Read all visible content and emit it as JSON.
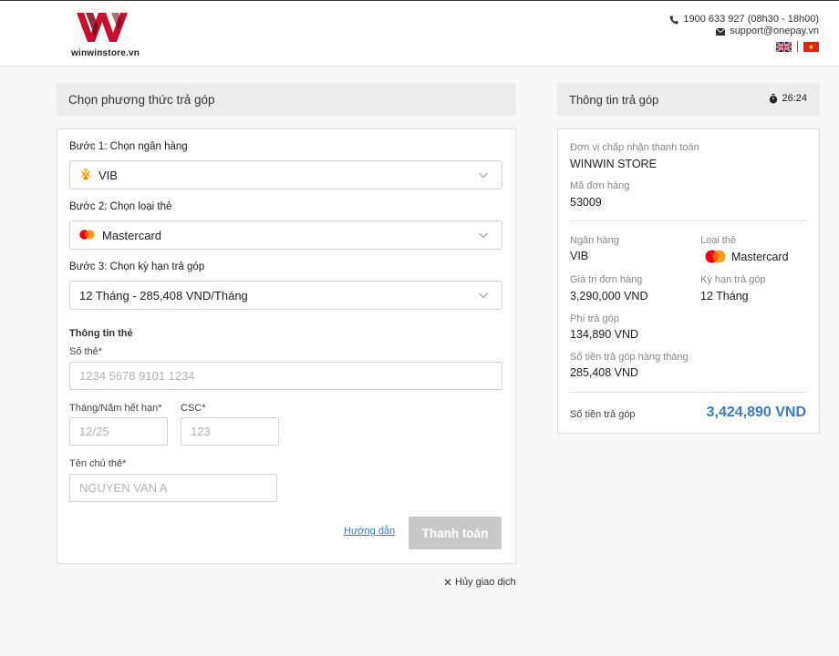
{
  "header": {
    "logo_text": "winwinstore.vn",
    "phone": "1900 633 927 (08h30 - 18h00)",
    "email": "support@onepay.vn"
  },
  "left_panel": {
    "title": "Chọn phương thức trả góp",
    "step1_label": "Bước 1: Chọn ngân hàng",
    "bank_value": "VIB",
    "step2_label": "Bước 2: Chọn loại thẻ",
    "card_type_value": "Mastercard",
    "step3_label": "Bước 3: Chọn kỳ hạn trả góp",
    "term_value": "12 Tháng - 285,408 VND/Tháng",
    "card_info_title": "Thông tin thẻ",
    "card_number_label": "Số thẻ*",
    "card_number_placeholder": "1234 5678 9101 1234",
    "expiry_label": "Tháng/Năm hết hạn*",
    "expiry_placeholder": "12/25",
    "csc_label": "CSC*",
    "csc_placeholder": "123",
    "holder_label": "Tên chủ thẻ*",
    "holder_placeholder": "NGUYEN VAN A",
    "help_link": "Hướng dẫn",
    "pay_button": "Thanh toán"
  },
  "cancel_label": "Hủy giao dịch",
  "right_panel": {
    "title": "Thông tin trả góp",
    "timer": "26:24",
    "merchant_label": "Đơn vị chấp nhận thanh toán",
    "merchant_value": "WINWIN STORE",
    "order_label": "Mã đơn hàng",
    "order_value": "53009",
    "bank_label": "Ngân hàng",
    "bank_value": "VIB",
    "card_type_label": "Loại thẻ",
    "card_type_value": "Mastercard",
    "order_amount_label": "Giá trị đơn hàng",
    "order_amount_value": "3,290,000 VND",
    "term_label": "Kỳ hạn trả góp",
    "term_value": "12 Tháng",
    "fee_label": "Phí trả góp",
    "fee_value": "134,890 VND",
    "monthly_label": "Số tiền trả góp hàng tháng",
    "monthly_value": "285,408 VND",
    "total_label": "Số tiền trả góp",
    "total_value": "3,424,890 VND"
  },
  "colors": {
    "accent": "#3a7bc8",
    "brand_red": "#c8102e",
    "disabled_button": "#c9c9c9"
  }
}
